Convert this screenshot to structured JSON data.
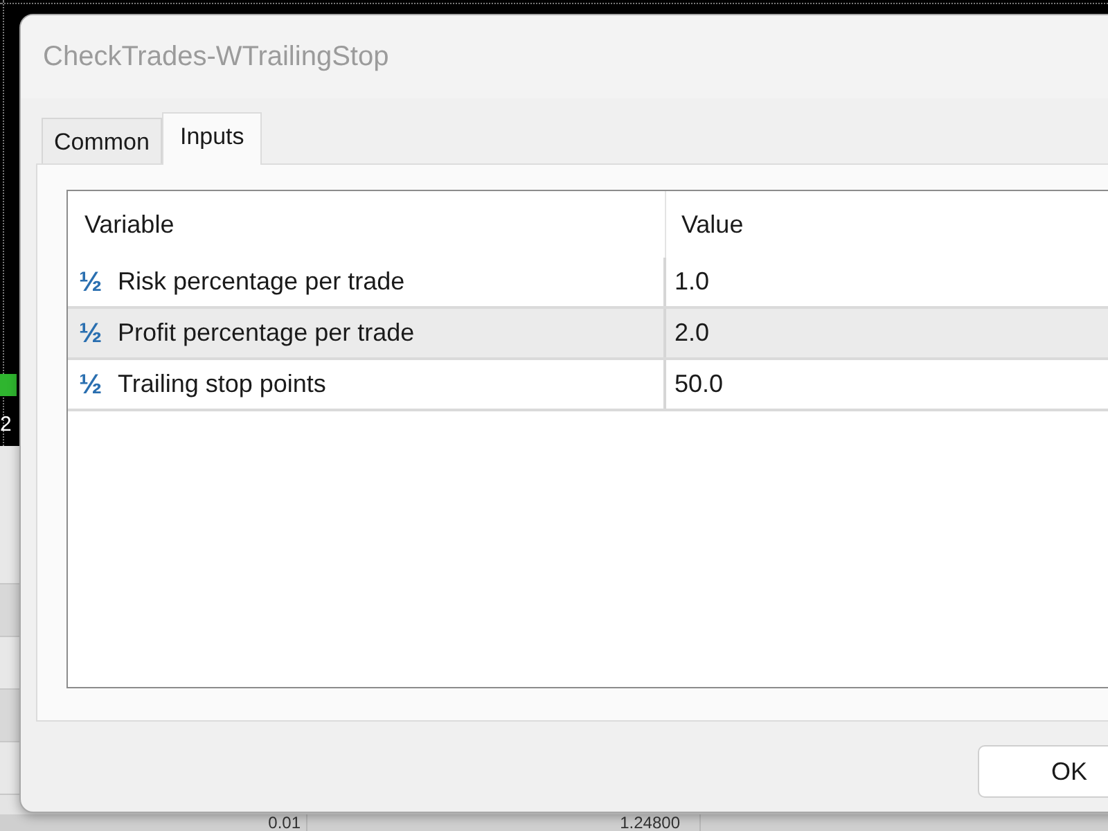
{
  "window": {
    "title": "CheckTrades-WTrailingStop"
  },
  "tabs": [
    {
      "label": "Common",
      "selected": false
    },
    {
      "label": "Inputs",
      "selected": true
    }
  ],
  "table": {
    "columns": [
      "Variable",
      "Value"
    ],
    "rows": [
      {
        "icon": "½",
        "variable": "Risk percentage per trade",
        "value": "1.0",
        "selected": false
      },
      {
        "icon": "½",
        "variable": "Profit percentage per trade",
        "value": "2.0",
        "selected": true
      },
      {
        "icon": "½",
        "variable": "Trailing stop points",
        "value": "50.0",
        "selected": false
      }
    ]
  },
  "buttons": [
    "OK"
  ],
  "background": {
    "chart_label": "2",
    "table_cells": [
      "0.01",
      "1.24800"
    ]
  }
}
